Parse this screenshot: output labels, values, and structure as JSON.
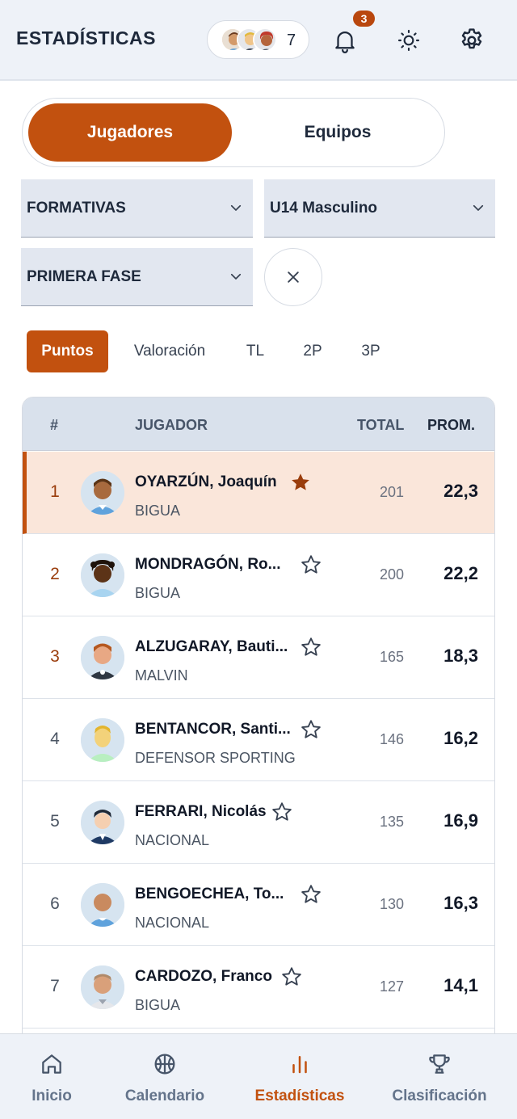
{
  "header": {
    "title": "ESTADÍSTICAS",
    "favorites_count": "7",
    "notifications_badge": "3"
  },
  "segment": {
    "active": "Jugadores",
    "inactive": "Equipos"
  },
  "filters": {
    "category": "FORMATIVAS",
    "division": "U14 Masculino",
    "phase": "PRIMERA FASE"
  },
  "stat_tabs": [
    "Puntos",
    "Valoración",
    "TL",
    "2P",
    "3P"
  ],
  "table": {
    "headers": {
      "rank": "#",
      "player": "JUGADOR",
      "total": "TOTAL",
      "avg": "PROM."
    },
    "rows": [
      {
        "rank": "1",
        "name": "OYARZÚN, Joaquín",
        "team": "BIGUA",
        "total": "201",
        "avg": "22,3",
        "favorite": true
      },
      {
        "rank": "2",
        "name": "MONDRAGÓN, Ro...",
        "team": "BIGUA",
        "total": "200",
        "avg": "22,2",
        "favorite": false
      },
      {
        "rank": "3",
        "name": "ALZUGARAY, Bauti...",
        "team": "MALVIN",
        "total": "165",
        "avg": "18,3",
        "favorite": false
      },
      {
        "rank": "4",
        "name": "BENTANCOR, Santi...",
        "team": "DEFENSOR SPORTING",
        "total": "146",
        "avg": "16,2",
        "favorite": false
      },
      {
        "rank": "5",
        "name": "FERRARI, Nicolás",
        "team": "NACIONAL",
        "total": "135",
        "avg": "16,9",
        "favorite": false
      },
      {
        "rank": "6",
        "name": "BENGOECHEA, To...",
        "team": "NACIONAL",
        "total": "130",
        "avg": "16,3",
        "favorite": false
      },
      {
        "rank": "7",
        "name": "CARDOZO, Franco",
        "team": "BIGUA",
        "total": "127",
        "avg": "14,1",
        "favorite": false
      }
    ]
  },
  "nav": {
    "home": "Inicio",
    "calendar": "Calendario",
    "stats": "Estadísticas",
    "standings": "Clasificación"
  },
  "colors": {
    "accent": "#c2510f",
    "header_bg": "#eef2f8",
    "highlight_row": "#fae6da"
  }
}
